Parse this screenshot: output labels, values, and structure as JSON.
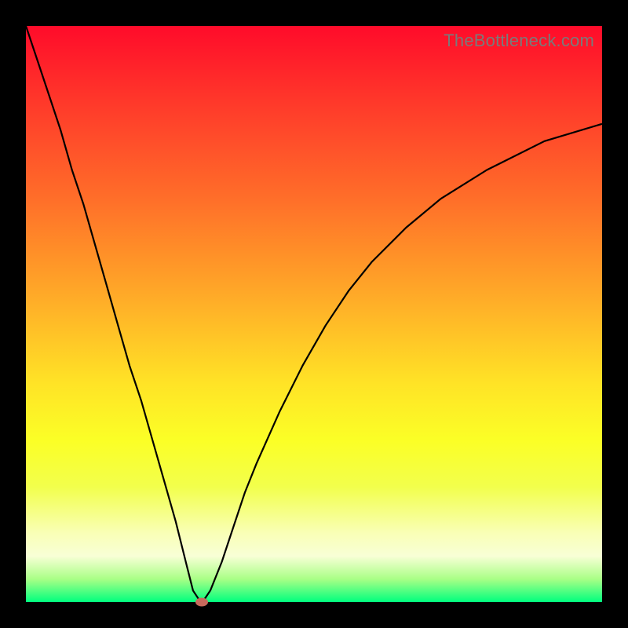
{
  "watermark": "TheBottleneck.com",
  "colors": {
    "frame": "#000000",
    "curve_stroke": "#000000",
    "marker": "#c76a5c",
    "gradient_top": "#ff0b2a",
    "gradient_bottom": "#00ff7e"
  },
  "chart_data": {
    "type": "line",
    "title": "",
    "xlabel": "",
    "ylabel": "",
    "xlim": [
      0,
      100
    ],
    "ylim": [
      0,
      100
    ],
    "grid": false,
    "legend": false,
    "notes": "Background is a vertical color gradient from red (top, high bottleneck) through orange/yellow to green (bottom, no bottleneck). A single black curve descends steeply from the top-left, reaches ~0 near x≈30, then rises with diminishing slope toward the right. A small reddish marker sits at the curve minimum.",
    "series": [
      {
        "name": "bottleneck-curve",
        "x": [
          0,
          2,
          4,
          6,
          8,
          10,
          12,
          14,
          16,
          18,
          20,
          22,
          24,
          26,
          28,
          29,
          30,
          31,
          32,
          34,
          36,
          38,
          40,
          44,
          48,
          52,
          56,
          60,
          66,
          72,
          80,
          90,
          100
        ],
        "y": [
          100,
          94,
          88,
          82,
          75,
          69,
          62,
          55,
          48,
          41,
          35,
          28,
          21,
          14,
          6,
          2,
          0.5,
          0.5,
          2,
          7,
          13,
          19,
          24,
          33,
          41,
          48,
          54,
          59,
          65,
          70,
          75,
          80,
          83
        ]
      }
    ],
    "marker": {
      "x": 30.5,
      "y": 0
    }
  }
}
